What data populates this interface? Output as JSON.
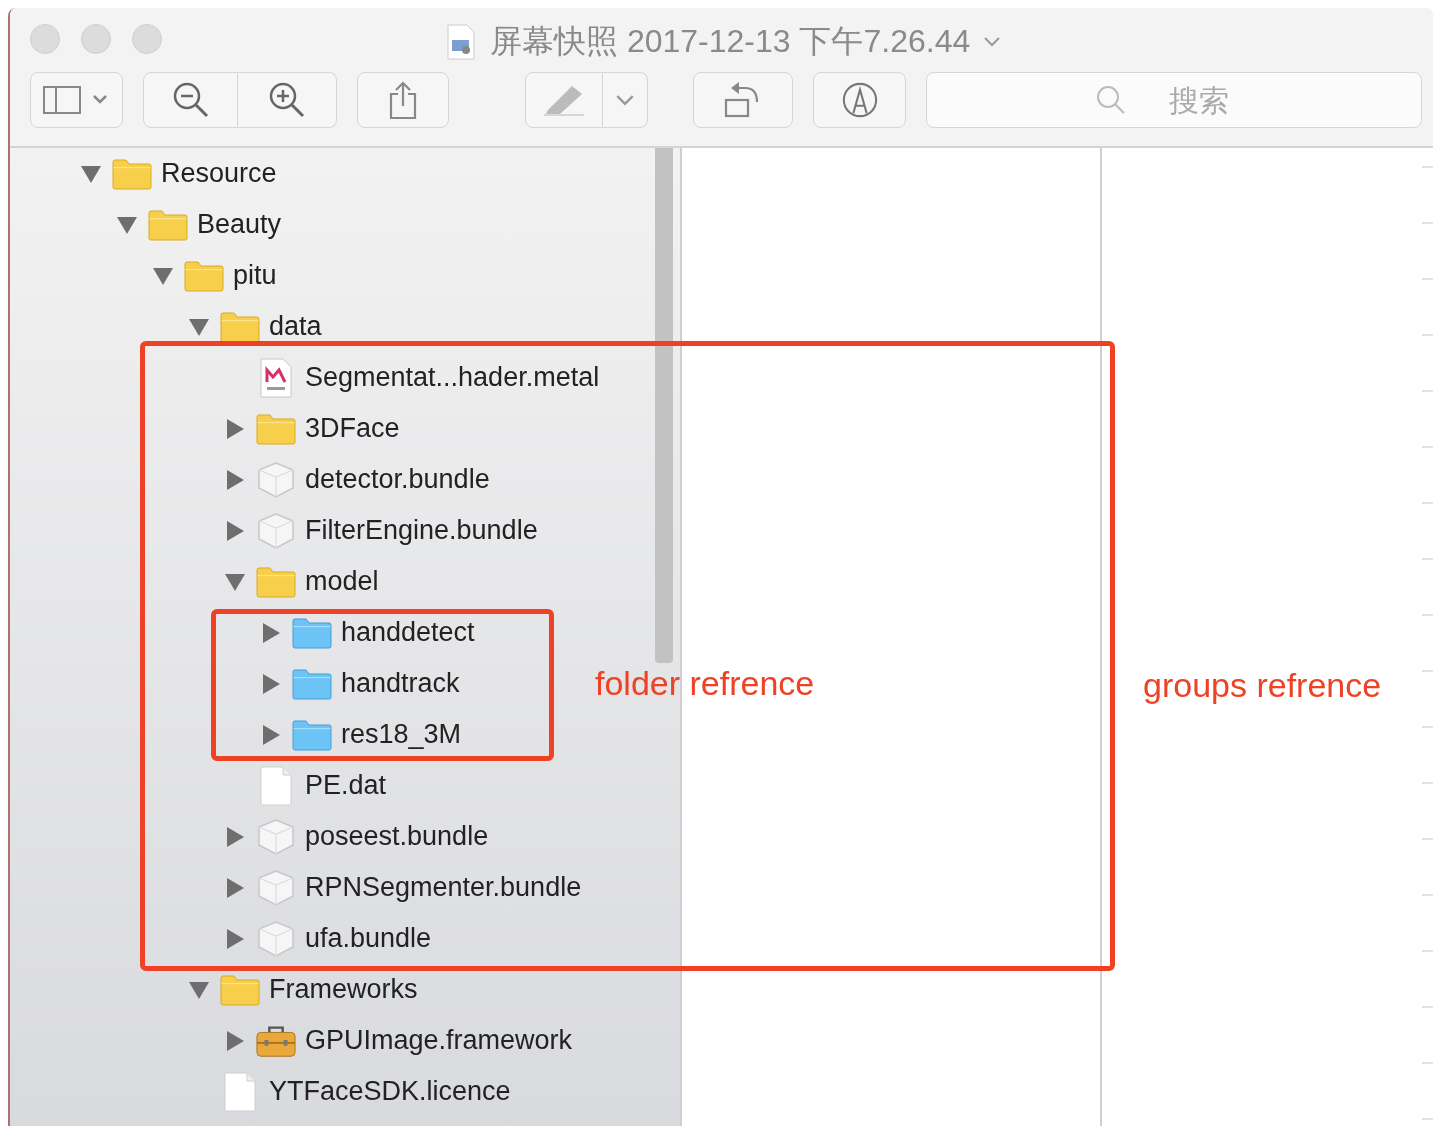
{
  "window": {
    "title": "屏幕快照 2017-12-13 下午7.26.44"
  },
  "toolbar": {
    "search": {
      "placeholder": "搜索"
    }
  },
  "navigator": {
    "items": [
      {
        "name": "Resource",
        "kind": "folder",
        "expanded": true,
        "children": [
          {
            "name": "Beauty",
            "kind": "folder",
            "expanded": true,
            "children": [
              {
                "name": "pitu",
                "kind": "folder",
                "expanded": true,
                "children": [
                  {
                    "name": "data",
                    "kind": "folder",
                    "expanded": true,
                    "children": [
                      {
                        "name": "Segmentat...hader.metal",
                        "kind": "metal"
                      },
                      {
                        "name": "3DFace",
                        "kind": "folder",
                        "expanded": false
                      },
                      {
                        "name": "detector.bundle",
                        "kind": "bundle",
                        "expanded": false
                      },
                      {
                        "name": "FilterEngine.bundle",
                        "kind": "bundle",
                        "expanded": false
                      },
                      {
                        "name": "model",
                        "kind": "folder",
                        "expanded": true,
                        "children": [
                          {
                            "name": "handdetect",
                            "kind": "reference",
                            "expanded": false
                          },
                          {
                            "name": "handtrack",
                            "kind": "reference",
                            "expanded": false
                          },
                          {
                            "name": "res18_3M",
                            "kind": "reference",
                            "expanded": false
                          }
                        ]
                      },
                      {
                        "name": "PE.dat",
                        "kind": "file"
                      },
                      {
                        "name": "poseest.bundle",
                        "kind": "bundle",
                        "expanded": false
                      },
                      {
                        "name": "RPNSegmenter.bundle",
                        "kind": "bundle",
                        "expanded": false
                      },
                      {
                        "name": "ufa.bundle",
                        "kind": "bundle",
                        "expanded": false
                      }
                    ]
                  },
                  {
                    "name": "Frameworks",
                    "kind": "folder",
                    "expanded": true,
                    "children": [
                      {
                        "name": "GPUImage.framework",
                        "kind": "framework",
                        "expanded": false
                      }
                    ]
                  },
                  {
                    "name": "YTFaceSDK.licence",
                    "kind": "file"
                  }
                ]
              }
            ]
          }
        ]
      }
    ]
  },
  "annotations": [
    {
      "label": "folder refrence"
    },
    {
      "label": "groups refrence"
    }
  ]
}
